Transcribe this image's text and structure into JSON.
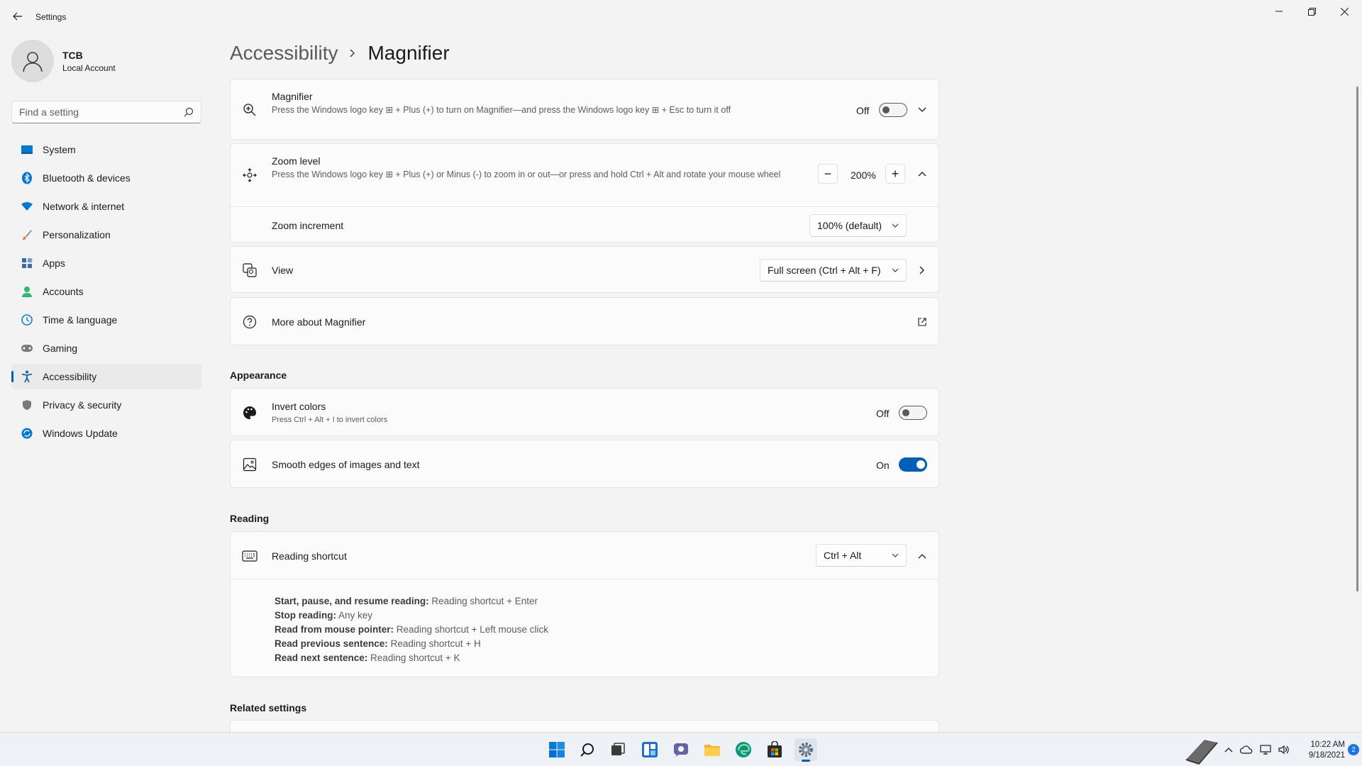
{
  "window": {
    "title": "Settings"
  },
  "user": {
    "name": "TCB",
    "account_type": "Local Account"
  },
  "search": {
    "placeholder": "Find a setting"
  },
  "nav": {
    "items": [
      {
        "label": "System",
        "icon": "monitor-icon",
        "color": "#0078d4"
      },
      {
        "label": "Bluetooth & devices",
        "icon": "bluetooth-icon",
        "color": "#0078d4"
      },
      {
        "label": "Network & internet",
        "icon": "wifi-icon",
        "color": "#0078d4"
      },
      {
        "label": "Personalization",
        "icon": "brush-icon",
        "color": "#e07a3a"
      },
      {
        "label": "Apps",
        "icon": "apps-icon",
        "color": "#3a6ea5"
      },
      {
        "label": "Accounts",
        "icon": "person-icon",
        "color": "#2eb872"
      },
      {
        "label": "Time & language",
        "icon": "globe-clock-icon",
        "color": "#0a84c8"
      },
      {
        "label": "Gaming",
        "icon": "gamepad-icon",
        "color": "#7a7a7a"
      },
      {
        "label": "Accessibility",
        "icon": "accessibility-icon",
        "color": "#1a5fb4"
      },
      {
        "label": "Privacy & security",
        "icon": "shield-icon",
        "color": "#7a7a7a"
      },
      {
        "label": "Windows Update",
        "icon": "update-icon",
        "color": "#0078d4"
      }
    ],
    "active_index": 8
  },
  "breadcrumb": {
    "parent": "Accessibility",
    "current": "Magnifier"
  },
  "magnifier": {
    "title": "Magnifier",
    "description": "Press the Windows logo key ⊞ + Plus (+) to turn on Magnifier—and press the Windows logo key ⊞ + Esc to turn it off",
    "state_label": "Off",
    "on": false
  },
  "zoom_level": {
    "title": "Zoom level",
    "description": "Press the Windows logo key ⊞ + Plus (+) or Minus (-) to zoom in or out—or press and hold Ctrl + Alt and rotate your mouse wheel",
    "value": "200%",
    "minus": "−",
    "plus": "+"
  },
  "zoom_increment": {
    "title": "Zoom increment",
    "value": "100% (default)"
  },
  "view": {
    "title": "View",
    "value": "Full screen (Ctrl + Alt + F)"
  },
  "more_about": {
    "title": "More about Magnifier"
  },
  "appearance": {
    "heading": "Appearance",
    "invert": {
      "title": "Invert colors",
      "description": "Press Ctrl + Alt + I to invert colors",
      "state_label": "Off",
      "on": false
    },
    "smooth": {
      "title": "Smooth edges of images and text",
      "state_label": "On",
      "on": true
    }
  },
  "reading": {
    "heading": "Reading",
    "shortcut_title": "Reading shortcut",
    "shortcut_value": "Ctrl + Alt",
    "lines": [
      {
        "k": "Start, pause, and resume reading:",
        "v": " Reading shortcut + Enter"
      },
      {
        "k": "Stop reading:",
        "v": " Any key"
      },
      {
        "k": "Read from mouse pointer:",
        "v": " Reading shortcut + Left mouse click"
      },
      {
        "k": "Read previous sentence:",
        "v": " Reading shortcut + H"
      },
      {
        "k": "Read next sentence:",
        "v": " Reading shortcut + K"
      }
    ]
  },
  "related": {
    "heading": "Related settings"
  },
  "taskbar": {
    "clock_time": "10:22 AM",
    "clock_date": "9/18/2021",
    "notification_count": "2",
    "accent": "#005fb8"
  }
}
